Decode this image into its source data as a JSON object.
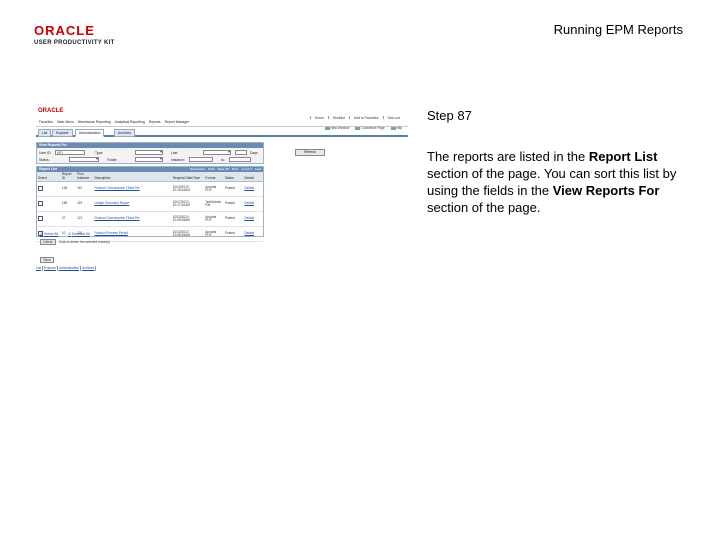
{
  "slide": {
    "logo_word": "ORACLE",
    "logo_sub": "USER PRODUCTIVITY KIT",
    "title": "Running EPM Reports",
    "step_label": "Step 87",
    "text_1": "The reports are listed in the ",
    "text_bold_1": "Report List",
    "text_2": " section of the page. You can sort this list by using the fields in the ",
    "text_bold_2": "View Reports For",
    "text_3": " section of the page."
  },
  "screenshot": {
    "oracle": "ORACLE",
    "top_links": [
      "Home",
      "Worklist",
      "Add to Favorites",
      "Sign out"
    ],
    "menu": [
      "Favorites",
      "Main Menu",
      "Warehouse Reporting",
      "Analytical Reporting",
      "Reports",
      "Report Manager"
    ],
    "tabs": [
      "List",
      "Explorer",
      "Administration",
      "Archives"
    ],
    "actions": [
      "New Window",
      "Customize Page",
      "http"
    ],
    "filters_head": "View Reports For",
    "filters": {
      "user_id_label": "User ID:",
      "user_id_value": "VP1",
      "type_label": "Type:",
      "last_label": "Last",
      "days_label": "Days",
      "status_label": "Status:",
      "folder_label": "Folder:",
      "instance_label": "Instance:",
      "to_label": "to:",
      "refresh": "Refresh"
    },
    "report_head": "Report List",
    "grid_tools": [
      "Customize",
      "Find",
      "View All",
      "First",
      "1-4 of 4",
      "Last"
    ],
    "columns": [
      "Select",
      "Report ID",
      "Prcs Instance",
      "Description",
      "Request Date/Time",
      "Format",
      "Status",
      "Details"
    ],
    "rows": [
      [
        "",
        "128",
        "112",
        "Product Consumption (Total Per",
        "10/23/2013 10:15:34AM",
        "Acrobat PDF",
        "Posted",
        "Details"
      ],
      [
        "",
        "158",
        "119",
        "Ledger Summary Report",
        "10/17/2013 10:17:40AM",
        "Text/Adobe File",
        "Posted",
        "Details"
      ],
      [
        "",
        "27",
        "121",
        "Product Consumption (Total Per",
        "10/23/2013 10:09:28AM",
        "Acrobat PDF",
        "Posted",
        "Details"
      ],
      [
        "",
        "10",
        "131",
        "Product Process Period",
        "10/13/2013 10:06:35AM",
        "Acrobat PDF",
        "Posted",
        "Details"
      ]
    ],
    "select_all": "Select All",
    "deselect_all": "Deselect All",
    "delete": "Delete",
    "delete_note": "Click to delete the selected report(s)",
    "save": "Save",
    "footer_links": [
      "List",
      "Explorer",
      "Administration",
      "Archives"
    ]
  }
}
